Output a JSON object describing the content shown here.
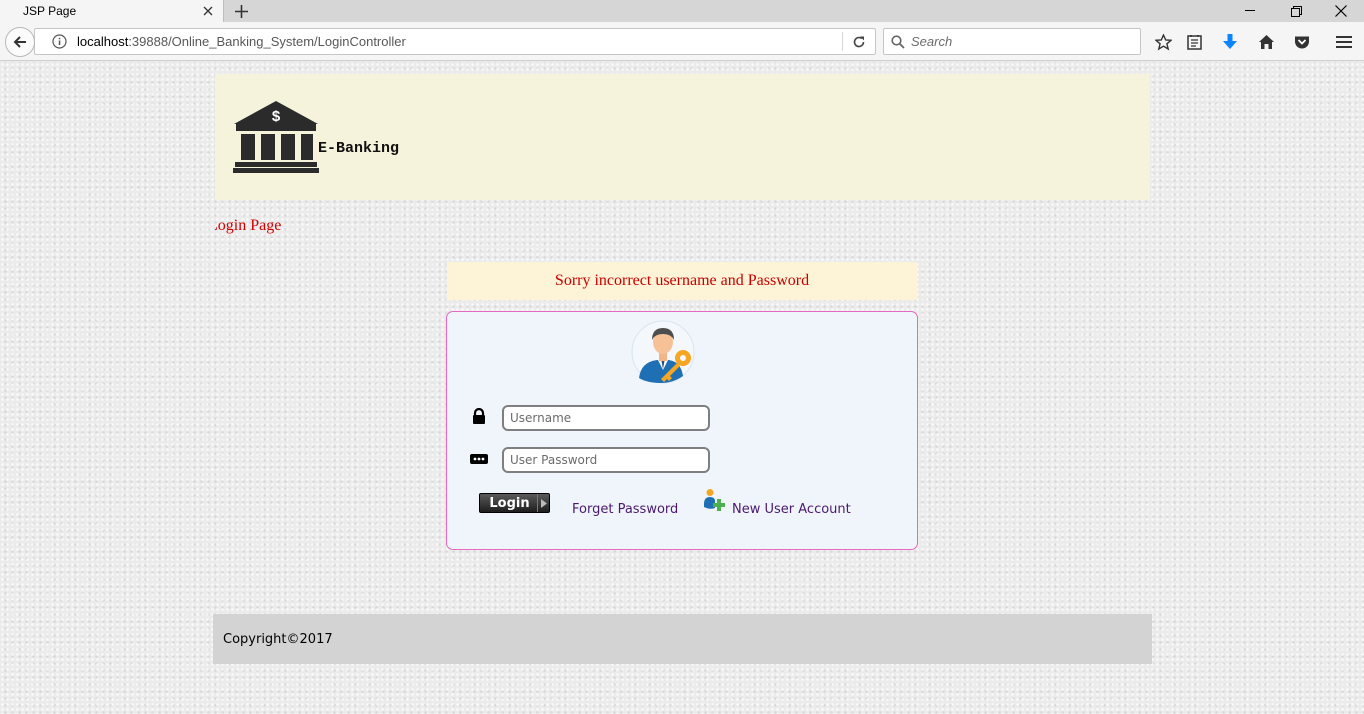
{
  "browser": {
    "tab_title": "JSP Page",
    "url_host": "localhost",
    "url_path": ":39888/Online_Banking_System/LoginController",
    "search_placeholder": "Search"
  },
  "header": {
    "logo_text": "E-Banking",
    "logo_symbol": "$"
  },
  "page_heading": "Login Page",
  "error_message": "Sorry incorrect username and Password",
  "login_form": {
    "username_placeholder": "Username",
    "password_placeholder": "User Password",
    "login_label": "Login",
    "forgot_password_label": "Forget Password",
    "new_user_label": "New User Account"
  },
  "footer": {
    "copyright": "Copyright©2017"
  },
  "colors": {
    "error_red": "#c80000",
    "header_bg": "#f5f3dc",
    "panel_border": "#e36ac0",
    "link": "#4b1a6e"
  }
}
